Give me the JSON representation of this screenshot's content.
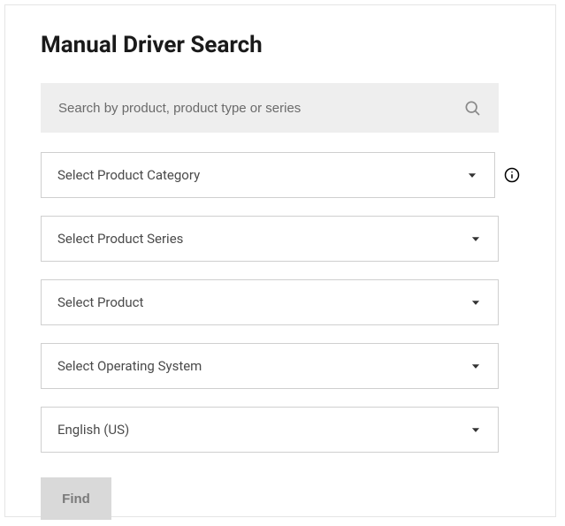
{
  "heading": "Manual Driver Search",
  "search": {
    "placeholder": "Search by product, product type or series",
    "value": ""
  },
  "dropdowns": {
    "product_category": {
      "label": "Select Product Category"
    },
    "product_series": {
      "label": "Select Product Series"
    },
    "product": {
      "label": "Select Product"
    },
    "operating_system": {
      "label": "Select Operating System"
    },
    "language": {
      "label": "English (US)"
    }
  },
  "find_button": "Find"
}
